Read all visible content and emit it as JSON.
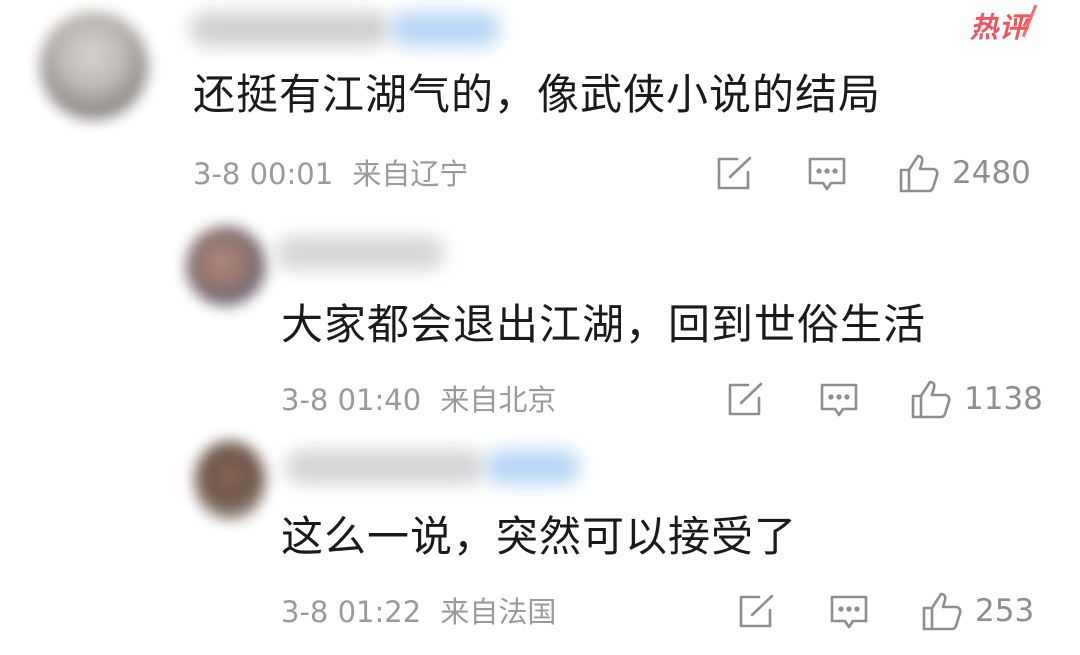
{
  "hot_badge": "热评",
  "colors": {
    "text": "#1a1a1a",
    "meta": "#9a9a9a",
    "icon": "#8e8e8e",
    "badge": "#f2545b",
    "username_highlight": "#a9cdf2"
  },
  "comments": [
    {
      "text": "还挺有江湖气的，像武侠小说的结局",
      "time": "3-8 00:01",
      "location": "来自辽宁",
      "likes": "2480",
      "icons": [
        "share-icon",
        "comment-icon",
        "like-icon"
      ]
    },
    {
      "text": "大家都会退出江湖，回到世俗生活",
      "time": "3-8 01:40",
      "location": "来自北京",
      "likes": "1138",
      "icons": [
        "share-icon",
        "comment-icon",
        "like-icon"
      ]
    },
    {
      "text": "这么一说，突然可以接受了",
      "time": "3-8 01:22",
      "location": "来自法国",
      "likes": "253",
      "icons": [
        "share-icon",
        "comment-icon",
        "like-icon"
      ]
    }
  ]
}
